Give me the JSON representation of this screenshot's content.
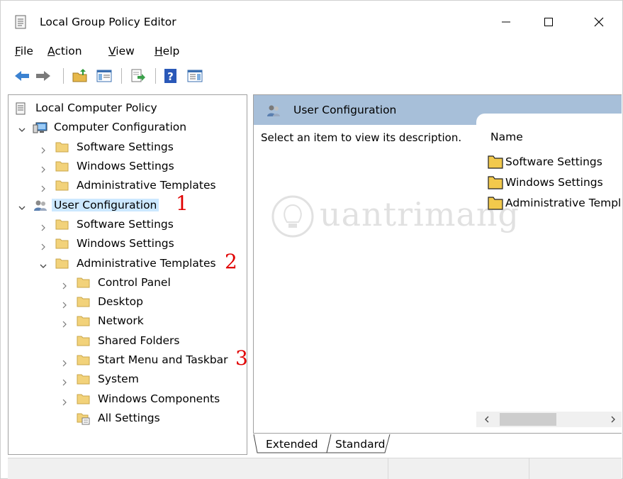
{
  "window": {
    "title": "Local Group Policy Editor"
  },
  "menu": {
    "items": [
      {
        "label": "File",
        "hot": "F",
        "rest": "ile"
      },
      {
        "label": "Action",
        "hot": "A",
        "rest": "ction"
      },
      {
        "label": "View",
        "hot": "V",
        "rest": "iew"
      },
      {
        "label": "Help",
        "hot": "H",
        "rest": "elp"
      }
    ]
  },
  "toolbar": {
    "buttons": [
      {
        "name": "back-icon"
      },
      {
        "name": "forward-icon"
      },
      {
        "name": "up-folder-icon"
      },
      {
        "name": "show-hide-tree-icon"
      },
      {
        "name": "export-list-icon"
      },
      {
        "name": "help-icon"
      },
      {
        "name": "filter-options-icon"
      }
    ]
  },
  "tree": {
    "root": "Local Computer Policy",
    "computer_config": {
      "label": "Computer Configuration",
      "children": [
        "Software Settings",
        "Windows Settings",
        "Administrative Templates"
      ]
    },
    "user_config": {
      "label": "User Configuration",
      "software": "Software Settings",
      "windows": "Windows Settings",
      "admin": {
        "label": "Administrative Templates",
        "children": [
          "Control Panel",
          "Desktop",
          "Network",
          "Shared Folders",
          "Start Menu and Taskbar",
          "System",
          "Windows Components",
          "All Settings"
        ]
      }
    }
  },
  "annotations": {
    "n1": "1",
    "n2": "2",
    "n3": "3"
  },
  "right_pane": {
    "header": "User Configuration",
    "description": "Select an item to view its description.",
    "column_name": "Name",
    "items": [
      "Software Settings",
      "Windows Settings",
      "Administrative Templ"
    ]
  },
  "tabs": {
    "extended": "Extended",
    "standard": "Standard"
  },
  "watermark": {
    "text": "uantrimang"
  },
  "colors": {
    "header_bg": "#a7bfd9",
    "folder": "#f2d27a",
    "annotation": "#e00000",
    "selected": "#cce8ff"
  }
}
